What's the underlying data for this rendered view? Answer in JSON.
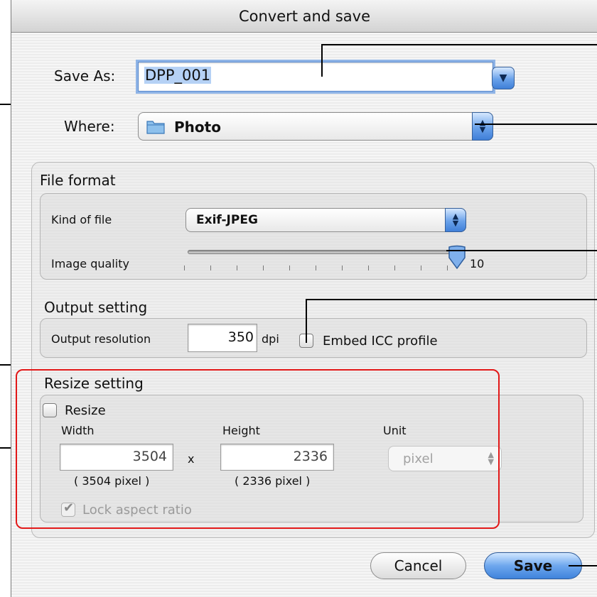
{
  "dialog": {
    "title": "Convert and save"
  },
  "save_as": {
    "label": "Save As:",
    "value": "DPP_001",
    "expand_icon": "triangle-down-icon"
  },
  "where": {
    "label": "Where:",
    "value": "Photo",
    "icon": "folder-icon"
  },
  "file_format": {
    "title": "File format",
    "kind_label": "Kind of file",
    "kind_value": "Exif-JPEG",
    "quality_label": "Image quality",
    "quality_value": "10",
    "quality_fraction": 1.0
  },
  "output_setting": {
    "title": "Output setting",
    "resolution_label": "Output resolution",
    "resolution_value": "350",
    "resolution_unit": "dpi",
    "embed_label": "Embed ICC profile",
    "embed_checked": false
  },
  "resize_setting": {
    "title": "Resize setting",
    "resize_label": "Resize",
    "resize_checked": false,
    "width_label": "Width",
    "height_label": "Height",
    "unit_label": "Unit",
    "width_value": "3504",
    "height_value": "2336",
    "times_symbol": "x",
    "width_pixels": "( 3504 pixel )",
    "height_pixels": "( 2336 pixel )",
    "unit_value": "pixel",
    "lock_label": "Lock aspect ratio",
    "lock_checked": true
  },
  "buttons": {
    "cancel": "Cancel",
    "save": "Save"
  },
  "colors": {
    "highlight_box": "#e21818",
    "accent_blue": "#3f83dc"
  }
}
